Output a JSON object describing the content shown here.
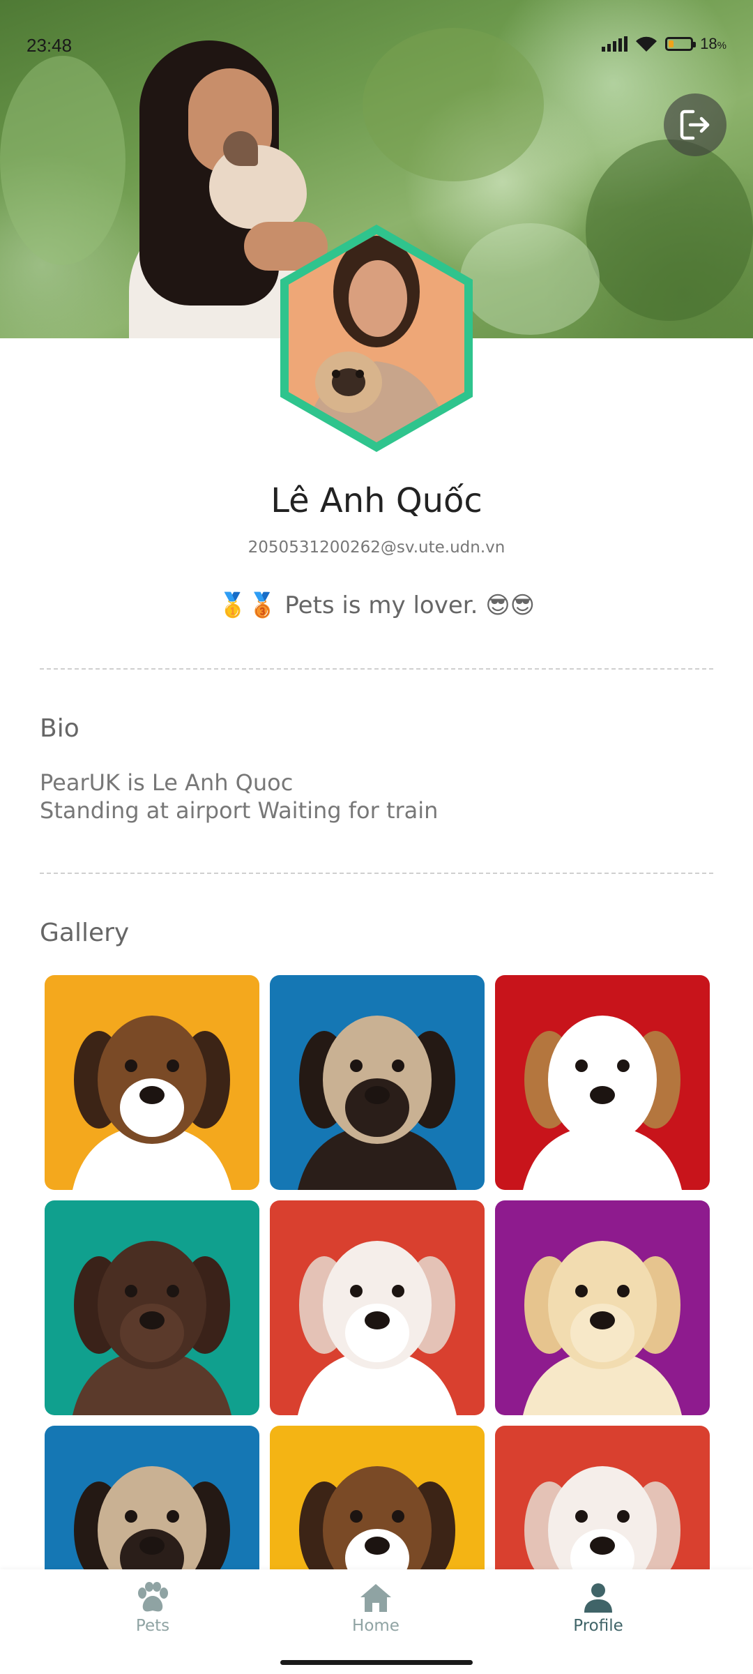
{
  "status_bar": {
    "time": "23:48",
    "battery_percent": "18",
    "battery_unit": "%"
  },
  "header": {
    "logout_icon": "logout-icon"
  },
  "profile": {
    "name": "Lê Anh Quốc",
    "email": "2050531200262@sv.ute.udn.vn",
    "status": "🥇🥉 Pets is my lover. 😎😎"
  },
  "bio": {
    "heading": "Bio",
    "lines": [
      "PearUK is Le Anh Quoc",
      "Standing at airport Waiting for train"
    ]
  },
  "gallery": {
    "heading": "Gallery",
    "items": [
      {
        "subject": "beagle puppy",
        "bg": "#f4a81d"
      },
      {
        "subject": "pug puppy",
        "bg": "#1577b4"
      },
      {
        "subject": "jack russell puppy",
        "bg": "#c8141b"
      },
      {
        "subject": "chocolate labrador puppy",
        "bg": "#10a08e"
      },
      {
        "subject": "bulldog puppy",
        "bg": "#d9402f"
      },
      {
        "subject": "golden retriever puppy",
        "bg": "#8e1b8e"
      },
      {
        "subject": "pug puppy",
        "bg": "#1577b4"
      },
      {
        "subject": "beagle puppy",
        "bg": "#f4b414"
      },
      {
        "subject": "bulldog puppy",
        "bg": "#d9402f"
      }
    ]
  },
  "nav": {
    "items": [
      {
        "label": "Pets",
        "icon": "paw-icon",
        "active": false
      },
      {
        "label": "Home",
        "icon": "home-icon",
        "active": false
      },
      {
        "label": "Profile",
        "icon": "person-icon",
        "active": true
      }
    ]
  },
  "colors": {
    "avatar_ring": "#2fc48d",
    "nav_active": "#406468",
    "nav_inactive": "#8fa3a3"
  }
}
